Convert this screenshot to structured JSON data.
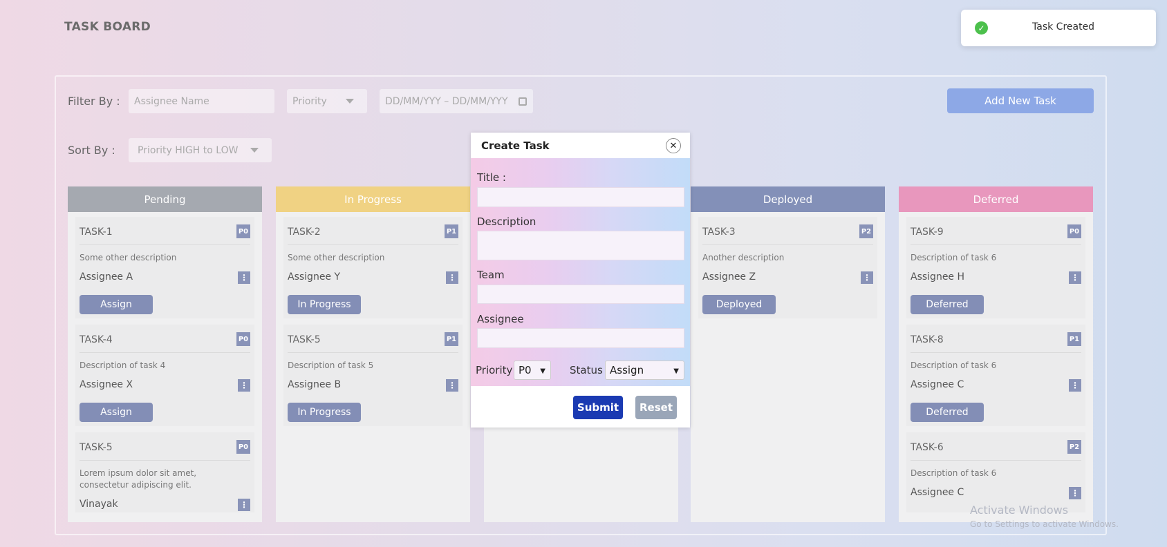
{
  "app": {
    "title": "TASK BOARD"
  },
  "toast": {
    "message": "Task Created",
    "icon": "check-circle-icon",
    "color": "#4cc04c"
  },
  "filters": {
    "filter_label": "Filter By :",
    "assignee_placeholder": "Assignee Name",
    "priority_placeholder": "Priority",
    "date_range_placeholder": "DD/MM/YYY –  DD/MM/YYY",
    "sort_label": "Sort By   :",
    "sort_value": "Priority HIGH to LOW",
    "add_button": "Add New Task"
  },
  "columns": [
    {
      "name": "Pending",
      "color": "#a5a9b0",
      "cards": [
        {
          "id": "TASK-1",
          "priority": "P0",
          "description": "Some other description",
          "assignee": "Assignee A",
          "status": "Assign"
        },
        {
          "id": "TASK-4",
          "priority": "P0",
          "description": "Description of task 4",
          "assignee": "Assignee X",
          "status": "Assign"
        },
        {
          "id": "TASK-5",
          "priority": "P0",
          "description": "Lorem ipsum dolor sit amet, consectetur adipiscing elit.",
          "assignee": "Vinayak",
          "status": ""
        }
      ]
    },
    {
      "name": "In Progress",
      "color": "#f0d283",
      "cards": [
        {
          "id": "TASK-2",
          "priority": "P1",
          "description": "Some other description",
          "assignee": "Assignee Y",
          "status": "In Progress"
        },
        {
          "id": "TASK-5",
          "priority": "P1",
          "description": "Description of task 5",
          "assignee": "Assignee B",
          "status": "In Progress"
        }
      ]
    },
    {
      "name": "",
      "color": "#f0f0f1",
      "cards": []
    },
    {
      "name": "Deployed",
      "color": "#8390b8",
      "cards": [
        {
          "id": "TASK-3",
          "priority": "P2",
          "description": "Another description",
          "assignee": "Assignee Z",
          "status": "Deployed"
        }
      ]
    },
    {
      "name": "Deferred",
      "color": "#e897bd",
      "cards": [
        {
          "id": "TASK-9",
          "priority": "P0",
          "description": "Description of task 6",
          "assignee": "Assignee H",
          "status": "Deferred"
        },
        {
          "id": "TASK-8",
          "priority": "P1",
          "description": "Description of task 6",
          "assignee": "Assignee C",
          "status": "Deferred"
        },
        {
          "id": "TASK-6",
          "priority": "P2",
          "description": "Description of task 6",
          "assignee": "Assignee C",
          "status": ""
        }
      ]
    }
  ],
  "modal": {
    "title": "Create Task",
    "title_label": "Title :",
    "title_value": "",
    "description_label": "Description",
    "description_value": "",
    "team_label": "Team",
    "team_value": "",
    "assignee_label": "Assignee",
    "assignee_value": "",
    "priority_label": "Priority",
    "priority_value": "P0",
    "status_label": "Status",
    "status_value": "Assign",
    "submit": "Submit",
    "reset": "Reset"
  },
  "watermark": {
    "line1": "Activate Windows",
    "line2": "Go to Settings to activate Windows."
  }
}
